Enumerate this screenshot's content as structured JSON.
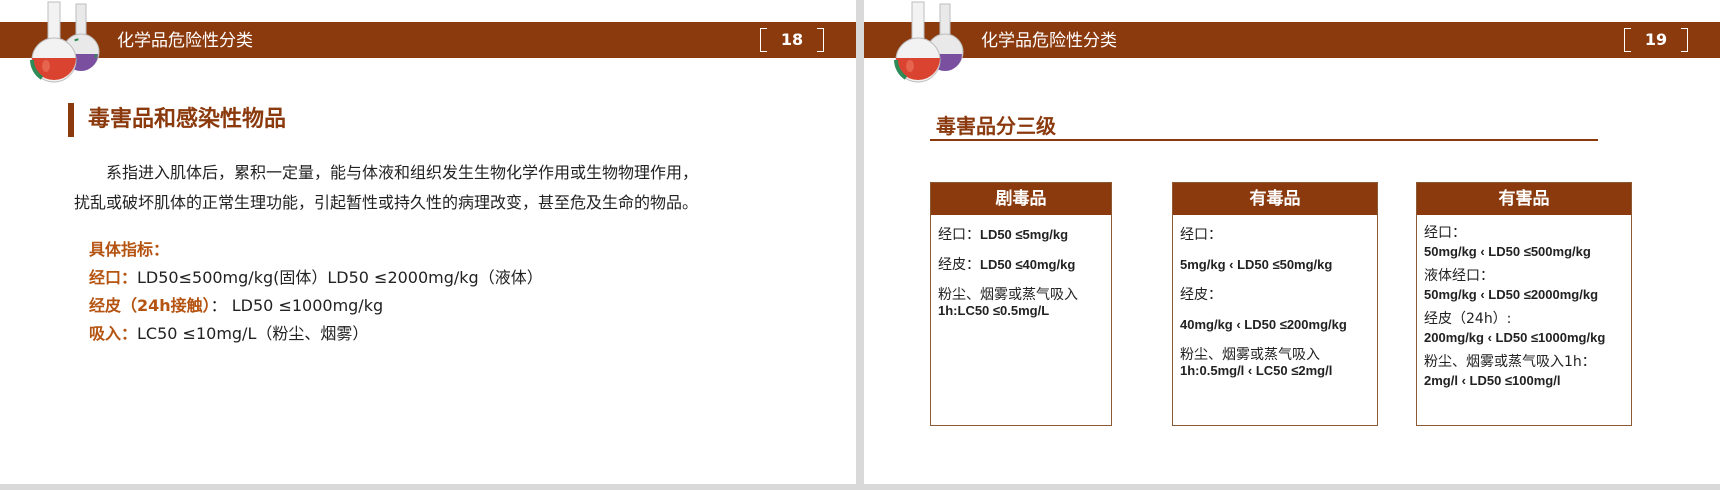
{
  "slides": [
    {
      "header_title": "化学品危险性分类",
      "page_number": "18",
      "section_heading": "毒害品和感染性物品",
      "paragraph": {
        "line1": "系指进入肌体后，累积一定量，能与体液和组织发生生物化学作用或生物物理作用，",
        "line2": "扰乱或破坏肌体的正常生理功能，引起暂性或持久性的病理改变，甚至危及生命的物品。"
      },
      "spec_title": "具体指标：",
      "specs": [
        {
          "key": "经口：",
          "value": "LD50≤500mg/kg(固体）LD50 ≤2000mg/kg（液体）"
        },
        {
          "key": "经皮（24h接触）",
          "value": "：  LD50 ≤1000mg/kg"
        },
        {
          "key": "吸入：",
          "value": "LC50 ≤10mg/L（粉尘、烟雾）"
        }
      ]
    },
    {
      "header_title": "化学品危险性分类",
      "page_number": "19",
      "section_heading": "毒害品分三级",
      "cards": [
        {
          "title": "剧毒品",
          "l1_label": "经口：",
          "l1_value": "LD50 ≤5mg/kg",
          "l2_label": "经皮：",
          "l2_value": "LD50 ≤40mg/kg",
          "l3_label": "粉尘、烟雾或蒸气吸入",
          "l3_value": "1h:LC50 ≤0.5mg/L"
        },
        {
          "title": "有毒品",
          "l1_label": "经口：",
          "l1_value": "5mg/kg ‹ LD50 ≤50mg/kg",
          "l2_label": "经皮：",
          "l2_value": "40mg/kg ‹ LD50 ≤200mg/kg",
          "l3_label": "粉尘、烟雾或蒸气吸入",
          "l3_value": "1h:0.5mg/l ‹ LC50 ≤2mg/l"
        },
        {
          "title": "有害品",
          "l1_label": "经口：",
          "l1_value": "50mg/kg ‹ LD50 ≤500mg/kg",
          "l2_label": "液体经口：",
          "l2_value": "50mg/kg ‹ LD50 ≤2000mg/kg",
          "l3_label": "经皮（24h）:",
          "l3_value": "200mg/kg ‹ LD50 ≤1000mg/kg",
          "l4_label": "粉尘、烟雾或蒸气吸入1h：",
          "l4_value": "2mg/l ‹ LD50 ≤100mg/l"
        }
      ]
    }
  ],
  "colors": {
    "brand_brown": "#8b3a0e",
    "accent_orange": "#b55311",
    "flask_red": "#d9432f",
    "flask_purple": "#7b4fa0",
    "flask_green": "#2e8b57"
  },
  "icons": [
    "chemistry-flask-icon"
  ]
}
